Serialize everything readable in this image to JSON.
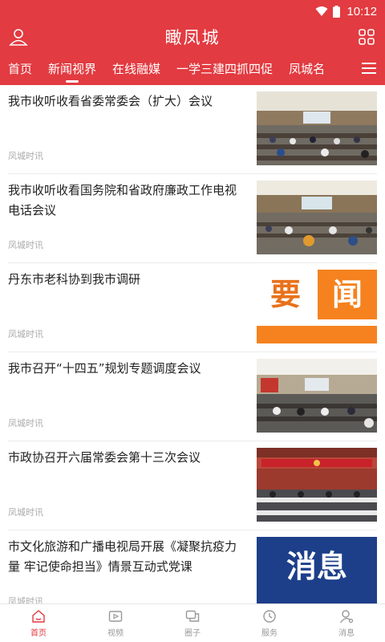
{
  "status_bar": {
    "time": "10:12"
  },
  "header": {
    "title": "瞰凤城"
  },
  "tabs": [
    {
      "label": "首页"
    },
    {
      "label": "新闻视界"
    },
    {
      "label": "在线融媒"
    },
    {
      "label": "一学三建四抓四促"
    },
    {
      "label": "凤城名"
    }
  ],
  "active_tab": "新闻视界",
  "news": [
    {
      "title": "我市收听收看省委常委会（扩大）会议",
      "source": "凤城时讯",
      "thumb": "meeting-photo"
    },
    {
      "title": "我市收听收看国务院和省政府廉政工作电视电话会议",
      "source": "凤城时讯",
      "thumb": "meeting-photo"
    },
    {
      "title": "丹东市老科协到我市调研",
      "source": "凤城时讯",
      "thumb": "yaowen-banner",
      "thumb_text": [
        "要",
        "闻"
      ]
    },
    {
      "title": "我市召开“十四五”规划专题调度会议",
      "source": "凤城时讯",
      "thumb": "meeting-photo"
    },
    {
      "title": "市政协召开六届常委会第十三次会议",
      "source": "凤城时讯",
      "thumb": "meeting-photo"
    },
    {
      "title": "市文化旅游和广播电视局开展《凝聚抗疫力量 牢记使命担当》情景互动式党课",
      "source": "凤城时讯",
      "thumb": "xiaoxi-banner",
      "thumb_text": "消息"
    }
  ],
  "bottom_nav": [
    {
      "label": "首页",
      "icon": "home-icon",
      "active": true
    },
    {
      "label": "视频",
      "icon": "video-icon",
      "active": false
    },
    {
      "label": "圈子",
      "icon": "chat-icon",
      "active": false
    },
    {
      "label": "服务",
      "icon": "clock-icon",
      "active": false
    },
    {
      "label": "消息",
      "icon": "user-message-icon",
      "active": false
    }
  ],
  "colors": {
    "brand": "#e23b41",
    "orange": "#f5821f",
    "navy": "#1d3f8a"
  }
}
